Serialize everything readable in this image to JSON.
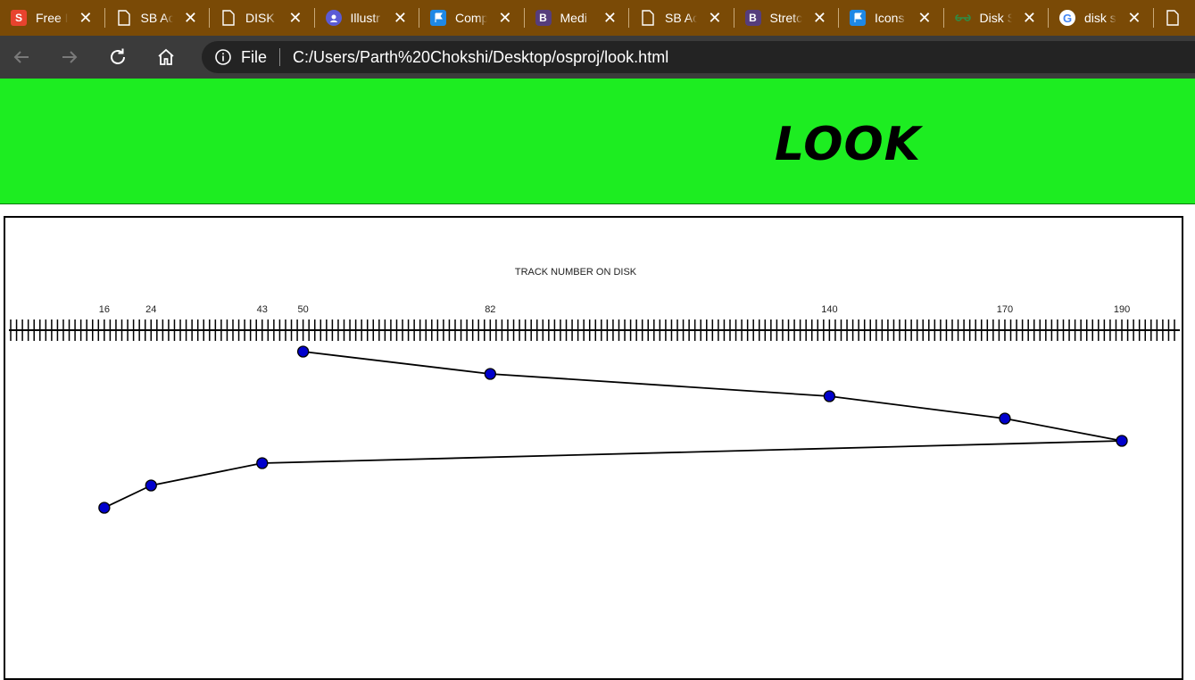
{
  "browser": {
    "tabs": [
      {
        "title": "Free I",
        "icon": "s-logo-icon",
        "icon_color": "#e8432e"
      },
      {
        "title": "SB Ac",
        "icon": "page-icon"
      },
      {
        "title": "DISK",
        "icon": "page-icon"
      },
      {
        "title": "Illustr",
        "icon": "illustrator-icon",
        "icon_color": "#5b5bd6"
      },
      {
        "title": "Comp",
        "icon": "flag-icon",
        "icon_color": "#1e88e5"
      },
      {
        "title": "Medi",
        "icon": "bootstrap-icon",
        "icon_color": "#563d7c"
      },
      {
        "title": "SB Ac",
        "icon": "page-icon"
      },
      {
        "title": "Stretc",
        "icon": "bootstrap-icon",
        "icon_color": "#563d7c"
      },
      {
        "title": "Icons",
        "icon": "flag-icon",
        "icon_color": "#1e88e5"
      },
      {
        "title": "Disk S",
        "icon": "gfg-icon",
        "icon_color": "#2f8d46"
      },
      {
        "title": "disk s",
        "icon": "google-icon"
      }
    ],
    "address": {
      "scheme_label": "File",
      "url": "C:/Users/Parth%20Chokshi/Desktop/osproj/look.html"
    }
  },
  "page": {
    "banner_title": "LOOK",
    "banner_color": "#1ded21"
  },
  "chart_data": {
    "type": "line",
    "title": "TRACK NUMBER ON DISK",
    "xlim": [
      0,
      199
    ],
    "tick_labels": [
      16,
      24,
      43,
      50,
      82,
      140,
      170,
      190
    ],
    "sequence": [
      50,
      82,
      140,
      170,
      190,
      43,
      24,
      16
    ],
    "point_color": "#0000cc",
    "line_color": "#000000"
  }
}
